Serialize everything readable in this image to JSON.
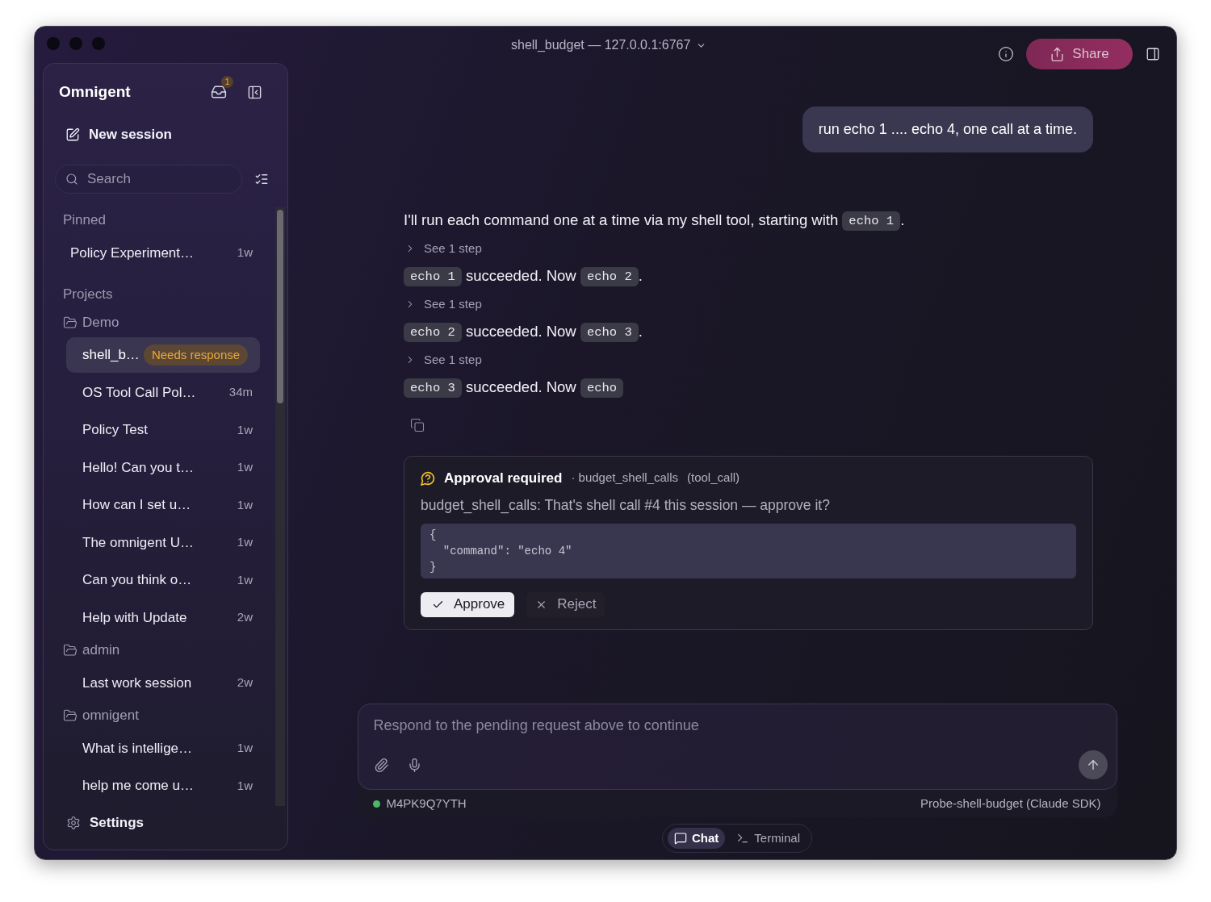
{
  "window": {
    "title": "shell_budget — 127.0.0.1:6767"
  },
  "toolbar": {
    "share_label": "Share"
  },
  "sidebar": {
    "app_name": "Omnigent",
    "inbox_count": "1",
    "new_session_label": "New session",
    "search": {
      "placeholder": "Search"
    },
    "pinned": {
      "heading": "Pinned",
      "sessions": [
        {
          "title": "Policy Experiment…",
          "age": "1w",
          "selected": false
        }
      ]
    },
    "projects": {
      "heading": "Projects",
      "folders": [
        {
          "name": "Demo",
          "sessions": [
            {
              "title": "shell_b…",
              "badge": "Needs response",
              "selected": true
            },
            {
              "title": "OS Tool Call Pol…",
              "age": "34m",
              "selected": false
            },
            {
              "title": "Policy Test",
              "age": "1w",
              "selected": false
            },
            {
              "title": "Hello! Can you t…",
              "age": "1w",
              "selected": false
            },
            {
              "title": "How can I set u…",
              "age": "1w",
              "selected": false
            },
            {
              "title": "The omnigent U…",
              "age": "1w",
              "selected": false
            },
            {
              "title": "Can you think o…",
              "age": "1w",
              "selected": false
            },
            {
              "title": "Help with Update",
              "age": "2w",
              "selected": false
            }
          ]
        },
        {
          "name": "admin",
          "sessions": [
            {
              "title": "Last work session",
              "age": "2w",
              "selected": false
            }
          ]
        },
        {
          "name": "omnigent",
          "sessions": [
            {
              "title": "What is intellige…",
              "age": "1w",
              "selected": false
            },
            {
              "title": "help me come u…",
              "age": "1w",
              "selected": false
            }
          ]
        }
      ]
    },
    "settings_label": "Settings"
  },
  "user_message": {
    "text": "run echo 1 .... echo 4, one call at a time."
  },
  "assistant": {
    "blocks": [
      {
        "kind": "paragraph",
        "parts": [
          {
            "kind": "text",
            "text": "I'll run each command one at a time via my shell tool, starting with "
          },
          {
            "kind": "code",
            "text": "echo 1"
          },
          {
            "kind": "text",
            "text": "."
          }
        ]
      },
      {
        "kind": "steps",
        "label": "See 1 step",
        "expanded": false
      },
      {
        "kind": "paragraph",
        "parts": [
          {
            "kind": "code",
            "text": "echo 1"
          },
          {
            "kind": "text",
            "text": " succeeded. Now "
          },
          {
            "kind": "code",
            "text": "echo 2"
          },
          {
            "kind": "text",
            "text": "."
          }
        ]
      },
      {
        "kind": "steps",
        "label": "See 1 step",
        "expanded": false
      },
      {
        "kind": "paragraph",
        "parts": [
          {
            "kind": "code",
            "text": "echo 2"
          },
          {
            "kind": "text",
            "text": " succeeded. Now "
          },
          {
            "kind": "code",
            "text": "echo 3"
          },
          {
            "kind": "text",
            "text": "."
          }
        ]
      },
      {
        "kind": "steps",
        "label": "See 1 step",
        "expanded": false
      },
      {
        "kind": "paragraph",
        "parts": [
          {
            "kind": "code",
            "text": "echo 3"
          },
          {
            "kind": "text",
            "text": " succeeded. Now "
          },
          {
            "kind": "code",
            "text": "echo"
          }
        ]
      }
    ]
  },
  "approval": {
    "title": "Approval required",
    "policy": "· budget_shell_calls",
    "call_type": "(tool_call)",
    "message": "budget_shell_calls: That's shell call #4 this session — approve it?",
    "payload": "{\n  \"command\": \"echo 4\"\n}",
    "actions": [
      {
        "kind": "approve",
        "label": "Approve"
      },
      {
        "kind": "reject",
        "label": "Reject"
      }
    ]
  },
  "composer": {
    "placeholder": "Respond to the pending request above to continue",
    "status": {
      "online": true,
      "session_id": "M4PK9Q7YTH",
      "agent": "Probe-shell-budget (Claude SDK)"
    }
  },
  "view_tabs": [
    {
      "kind": "chat",
      "label": "Chat",
      "selected": true
    },
    {
      "kind": "terminal",
      "label": "Terminal",
      "selected": false
    }
  ]
}
